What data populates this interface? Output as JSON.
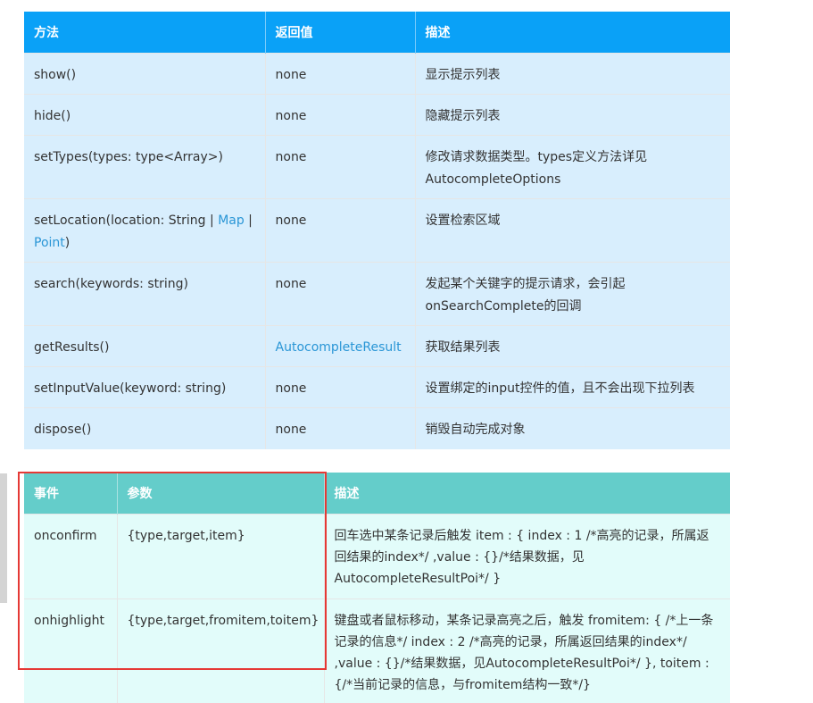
{
  "methods_table": {
    "headers": [
      "方法",
      "返回值",
      "描述"
    ],
    "rows": [
      {
        "method": "show()",
        "return": "none",
        "desc": "显示提示列表"
      },
      {
        "method": "hide()",
        "return": "none",
        "desc": "隐藏提示列表"
      },
      {
        "method": "setTypes(types: type<Array>)",
        "return": "none",
        "desc": "修改请求数据类型。types定义方法详见AutocompleteOptions"
      },
      {
        "method_prefix": "setLocation(location: String | ",
        "method_link1": "Map",
        "method_mid": " | ",
        "method_link2": "Point",
        "method_suffix": ")",
        "return": "none",
        "desc": "设置检索区域"
      },
      {
        "method": "search(keywords: string)",
        "return": "none",
        "desc": "发起某个关键字的提示请求，会引起onSearchComplete的回调"
      },
      {
        "method": "getResults()",
        "return_link": "AutocompleteResult",
        "desc": "获取结果列表"
      },
      {
        "method": "setInputValue(keyword: string)",
        "return": "none",
        "desc": "设置绑定的input控件的值，且不会出现下拉列表"
      },
      {
        "method": "dispose()",
        "return": "none",
        "desc": "销毁自动完成对象"
      }
    ]
  },
  "events_table": {
    "headers": [
      "事件",
      "参数",
      "描述"
    ],
    "rows": [
      {
        "event": "onconfirm",
        "params": "{type,target,item}",
        "desc": "回车选中某条记录后触发 item : { index : 1 /*高亮的记录，所属返回结果的index*/ ,value : {}/*结果数据，见AutocompleteResultPoi*/ }"
      },
      {
        "event": "onhighlight",
        "params": "{type,target,fromitem,toitem}",
        "desc": "键盘或者鼠标移动，某条记录高亮之后，触发 fromitem: { /*上一条记录的信息*/ index : 2 /*高亮的记录，所属返回结果的index*/ ,value : {}/*结果数据，见AutocompleteResultPoi*/ }, toitem : {/*当前记录的信息，与fromitem结构一致*/}"
      }
    ]
  },
  "colors": {
    "methods_header": "#0aa1f7",
    "methods_row": "#d8eefd",
    "events_header": "#64cdca",
    "events_row": "#e2fcfa",
    "link": "#2a96d6",
    "highlight_box": "#e53935"
  }
}
